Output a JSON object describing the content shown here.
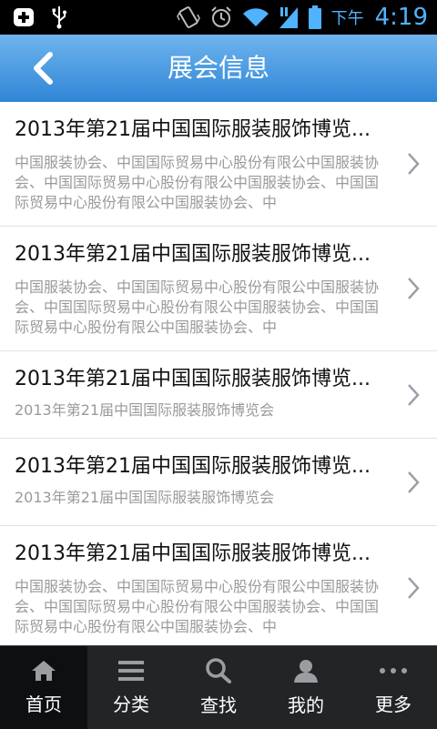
{
  "status_bar": {
    "ampm": "下午",
    "time": "4:19",
    "icons": [
      "plus-square-icon",
      "usb-icon",
      "vibrate-icon",
      "alarm-icon",
      "wifi-icon",
      "signal-icon",
      "battery-icon"
    ],
    "accent_color": "#4fb3ff"
  },
  "header": {
    "title": "展会信息",
    "back_icon": "chevron-left-icon"
  },
  "list": {
    "items": [
      {
        "title": "2013年第21届中国国际服装服饰博览...",
        "desc": "中国服装协会、中国国际贸易中心股份有限公中国服装协会、中国国际贸易中心股份有限公中国服装协会、中国国际贸易中心股份有限公中国服装协会、中"
      },
      {
        "title": "2013年第21届中国国际服装服饰博览...",
        "desc": "中国服装协会、中国国际贸易中心股份有限公中国服装协会、中国国际贸易中心股份有限公中国服装协会、中国国际贸易中心股份有限公中国服装协会、中"
      },
      {
        "title": "2013年第21届中国国际服装服饰博览...",
        "desc": "2013年第21届中国国际服装服饰博览会"
      },
      {
        "title": "2013年第21届中国国际服装服饰博览...",
        "desc": "2013年第21届中国国际服装服饰博览会"
      },
      {
        "title": "2013年第21届中国国际服装服饰博览...",
        "desc": "中国服装协会、中国国际贸易中心股份有限公中国服装协会、中国国际贸易中心股份有限公中国服装协会、中国国际贸易中心股份有限公中国服装协会、中"
      }
    ]
  },
  "tabbar": {
    "tabs": [
      {
        "label": "首页",
        "icon": "home-icon",
        "active": true
      },
      {
        "label": "分类",
        "icon": "list-icon",
        "active": false
      },
      {
        "label": "查找",
        "icon": "search-icon",
        "active": false
      },
      {
        "label": "我的",
        "icon": "user-icon",
        "active": false
      },
      {
        "label": "更多",
        "icon": "more-icon",
        "active": false
      }
    ]
  }
}
